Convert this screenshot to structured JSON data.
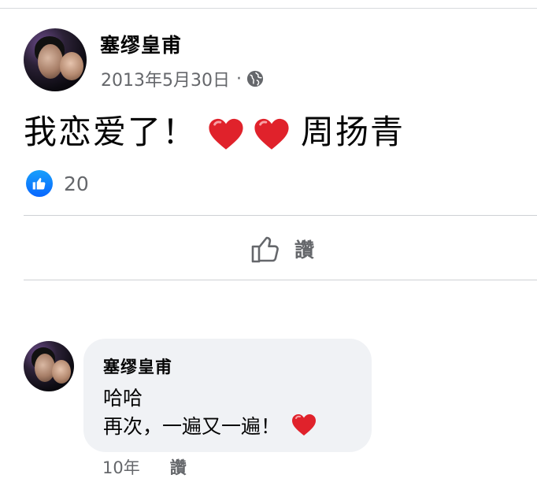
{
  "post": {
    "author": "塞缪皇甫",
    "date": "2013年5月30日",
    "separator": "·",
    "visibility_icon": "globe-icon",
    "text_before": "我恋爱了！",
    "emoji": "heart-emoji",
    "text_after": "周扬青",
    "reaction_icon": "like-icon",
    "reaction_count": "20",
    "like_label": "讚"
  },
  "comment": {
    "author": "塞缪皇甫",
    "line1": "哈哈",
    "line2": "再次，一遍又一遍！",
    "emoji": "heart-emoji",
    "age": "10年",
    "like_label": "讚"
  },
  "colors": {
    "like_blue": "#0866ff",
    "heart_red": "#e0222b",
    "secondary_text": "#65676b",
    "bubble_bg": "#f0f2f5"
  }
}
